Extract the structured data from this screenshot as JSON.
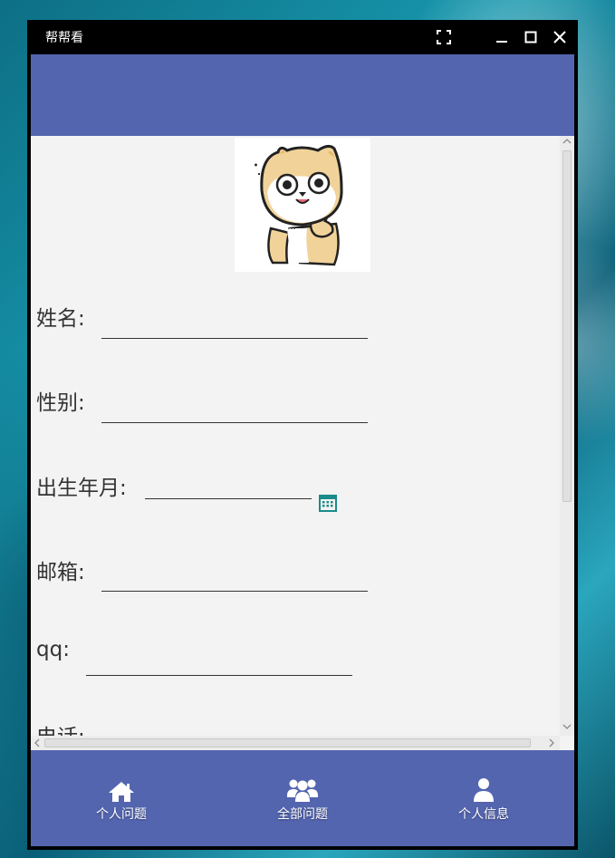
{
  "window": {
    "title": "帮帮看"
  },
  "titlebar_icons": [
    "fullscreen-icon",
    "minimize-icon",
    "maximize-icon",
    "close-icon"
  ],
  "form": {
    "fields": [
      {
        "label": "姓名:",
        "value": ""
      },
      {
        "label": "性别:",
        "value": ""
      },
      {
        "label": "出生年月:",
        "value": ""
      },
      {
        "label": "邮箱:",
        "value": ""
      },
      {
        "label": "qq:",
        "value": ""
      },
      {
        "label": "电话:",
        "value": ""
      }
    ]
  },
  "nav": {
    "items": [
      {
        "label": "个人问题",
        "icon": "home-icon"
      },
      {
        "label": "全部问题",
        "icon": "group-icon"
      },
      {
        "label": "个人信息",
        "icon": "user-icon"
      }
    ]
  },
  "colors": {
    "accent": "#5465b0",
    "content_bg": "#f3f3f3",
    "titlebar": "#000000",
    "calendar_icon": "#1a8a8a"
  }
}
